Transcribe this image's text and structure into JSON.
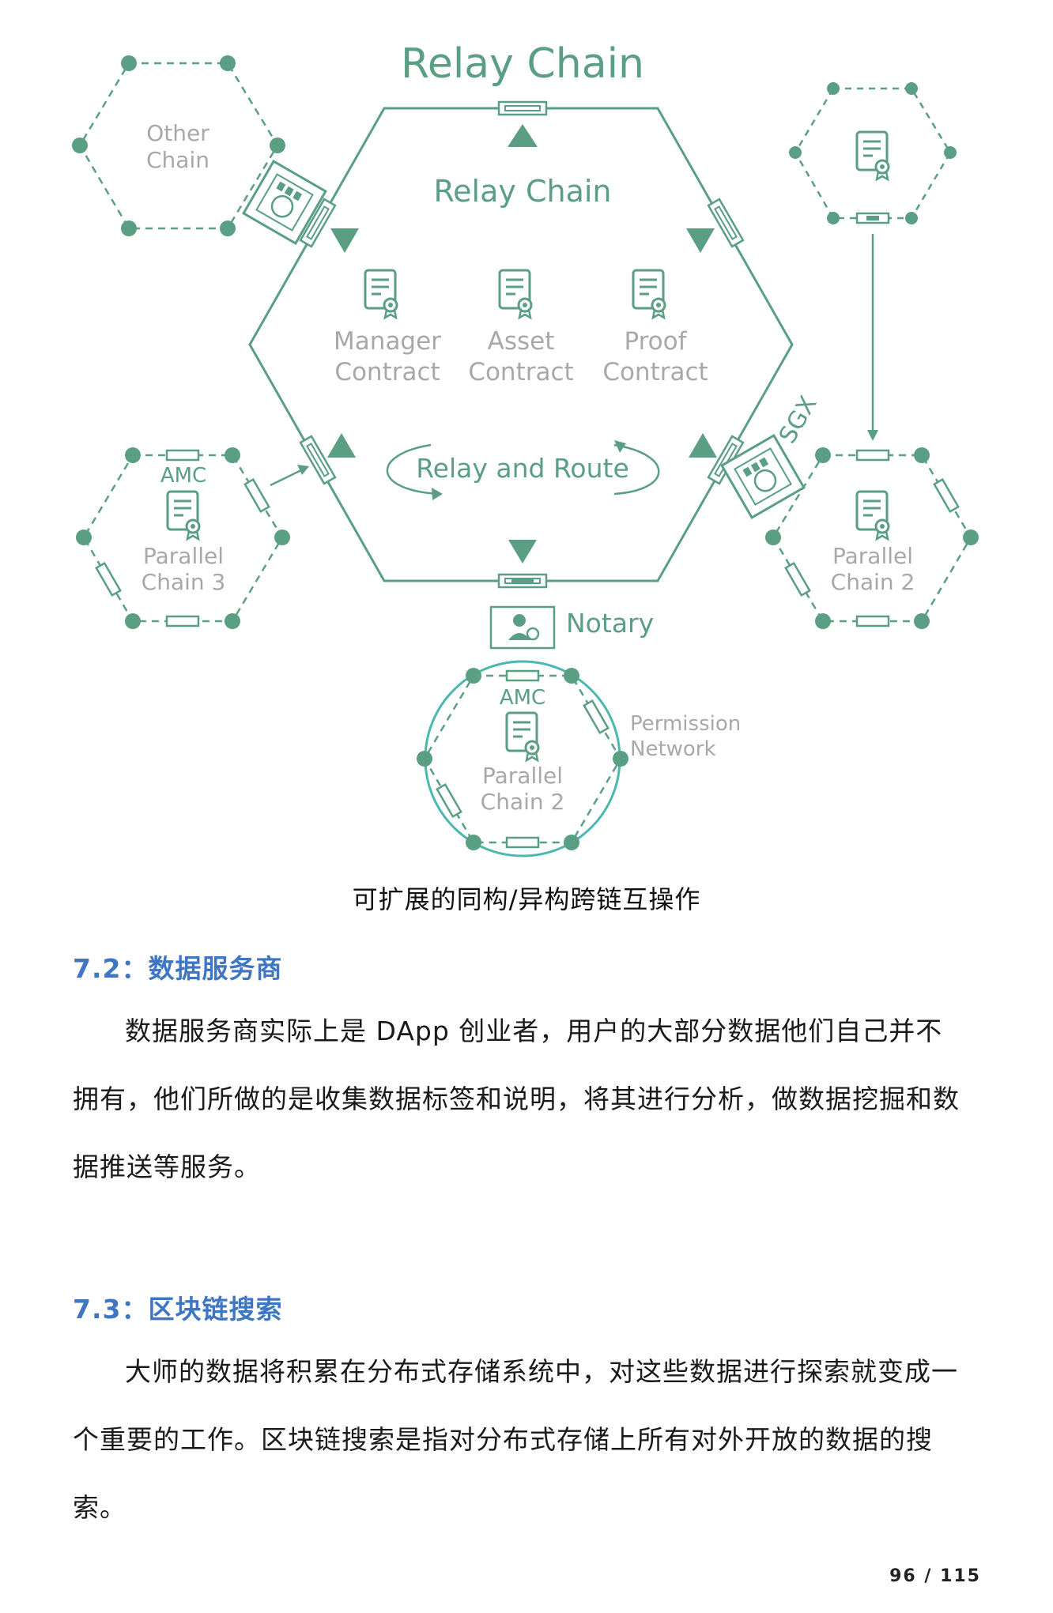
{
  "figure": {
    "title_top": "Relay Chain",
    "inner_title": "Relay Chain",
    "other_chain": [
      "Other",
      "Chain"
    ],
    "contracts": [
      {
        "line1": "Manager",
        "line2": "Contract"
      },
      {
        "line1": "Asset",
        "line2": "Contract"
      },
      {
        "line1": "Proof",
        "line2": "Contract"
      }
    ],
    "relay_route": "Relay and Route",
    "sgx": "SGX",
    "notary": "Notary",
    "left_chain": {
      "amc": "AMC",
      "line1": "Parallel",
      "line2": "Chain 3"
    },
    "right_chain": {
      "line1": "Parallel",
      "line2": "Chain 2"
    },
    "bottom_chain": {
      "amc": "AMC",
      "line1": "Parallel",
      "line2": "Chain 2"
    },
    "permission": [
      "Permission",
      "Network"
    ],
    "caption": "可扩展的同构/异构跨链互操作"
  },
  "sections": [
    {
      "heading": "7.2：数据服务商",
      "body": "数据服务商实际上是 DApp 创业者，用户的大部分数据他们自己并不拥有，他们所做的是收集数据标签和说明，将其进行分析，做数据挖掘和数据推送等服务。"
    },
    {
      "heading": "7.3：区块链搜索",
      "body": "大师的数据将积累在分布式存储系统中，对这些数据进行探索就变成一个重要的工作。区块链搜索是指对分布式存储上所有对外开放的数据的搜索。"
    }
  ],
  "page_number": "96 / 115",
  "colors": {
    "green": "#5a9e84",
    "light_text": "#a8a8a8",
    "teal": "#4bb8b0",
    "heading": "#3f76c4"
  },
  "icons": [
    "contract-doc-icon",
    "notary-user-icon",
    "sgx-chip-icon"
  ]
}
